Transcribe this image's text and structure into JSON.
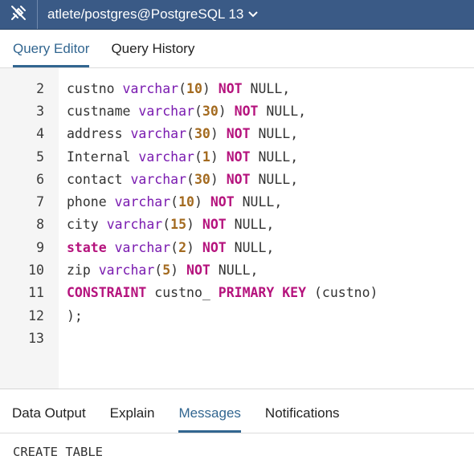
{
  "connection": {
    "label": "atlete/postgres@PostgreSQL 13",
    "icon": "connection-plug-icon",
    "chevron_icon": "chevron-down-icon"
  },
  "editor_tabs": [
    {
      "label": "Query Editor"
    },
    {
      "label": "Query History"
    }
  ],
  "code": {
    "line_numbers": [
      "2",
      "3",
      "4",
      "5",
      "6",
      "7",
      "8",
      "9",
      "10",
      "11",
      "12",
      "13"
    ],
    "lines": [
      {
        "col": "custno",
        "type": "varchar",
        "size": "10",
        "not": "NOT",
        "null": "NULL,"
      },
      {
        "col": "custname",
        "type": "varchar",
        "size": "30",
        "not": "NOT",
        "null": "NULL,"
      },
      {
        "col": "address",
        "type": "varchar",
        "size": "30",
        "not": "NOT",
        "null": "NULL,"
      },
      {
        "col": "Internal",
        "type": "varchar",
        "size": "1",
        "not": "NOT",
        "null": "NULL,"
      },
      {
        "col": "contact",
        "type": "varchar",
        "size": "30",
        "not": "NOT",
        "null": "NULL,"
      },
      {
        "col": "phone",
        "type": "varchar",
        "size": "10",
        "not": "NOT",
        "null": "NULL,"
      },
      {
        "col": "city",
        "type": "varchar",
        "size": "15",
        "not": "NOT",
        "null": "NULL,"
      },
      {
        "col": "state",
        "type": "varchar",
        "size": "2",
        "not": "NOT",
        "null": "NULL,"
      },
      {
        "col": "zip",
        "type": "varchar",
        "size": "5",
        "not": "NOT",
        "null": "NULL,"
      }
    ],
    "constraint": {
      "kw": "CONSTRAINT",
      "name": "custno_",
      "pk": "PRIMARY KEY",
      "cols": "(custno)"
    },
    "closing": ");"
  },
  "output_tabs": [
    {
      "label": "Data Output"
    },
    {
      "label": "Explain"
    },
    {
      "label": "Messages"
    },
    {
      "label": "Notifications"
    }
  ],
  "messages": {
    "text": "CREATE TABLE"
  },
  "colors": {
    "topbar": "#3a5a86",
    "active_tab": "#326690",
    "keyword": "#b5137d",
    "type": "#7a1bb0",
    "number": "#a36a1f"
  }
}
